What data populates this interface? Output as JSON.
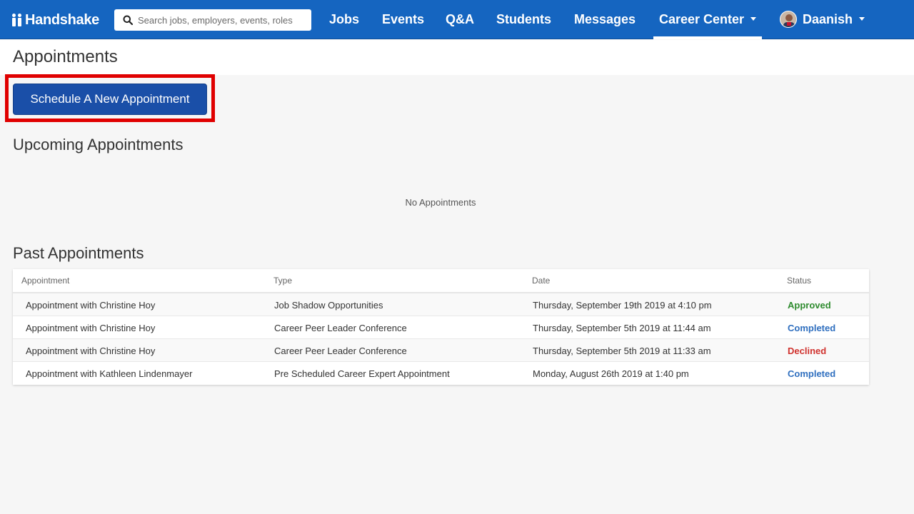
{
  "app": {
    "name": "Handshake"
  },
  "search": {
    "placeholder": "Search jobs, employers, events, roles"
  },
  "nav": {
    "items": [
      {
        "label": "Jobs"
      },
      {
        "label": "Events"
      },
      {
        "label": "Q&A"
      },
      {
        "label": "Students"
      },
      {
        "label": "Messages"
      },
      {
        "label": "Career Center"
      }
    ],
    "user": "Daanish"
  },
  "page": {
    "title": "Appointments",
    "schedule_button": "Schedule A New Appointment",
    "upcoming_title": "Upcoming Appointments",
    "upcoming_empty": "No Appointments",
    "past_title": "Past Appointments"
  },
  "past_table": {
    "headers": [
      "Appointment",
      "Type",
      "Date",
      "Status"
    ],
    "rows": [
      {
        "appointment": "Appointment with Christine Hoy",
        "type": "Job Shadow Opportunities",
        "date": "Thursday, September 19th 2019 at 4:10 pm",
        "status": "Approved",
        "status_color": "#2e8b2e"
      },
      {
        "appointment": "Appointment with Christine Hoy",
        "type": "Career Peer Leader Conference",
        "date": "Thursday, September 5th 2019 at 11:44 am",
        "status": "Completed",
        "status_color": "#2f6fbf"
      },
      {
        "appointment": "Appointment with Christine Hoy",
        "type": "Career Peer Leader Conference",
        "date": "Thursday, September 5th 2019 at 11:33 am",
        "status": "Declined",
        "status_color": "#d0312d"
      },
      {
        "appointment": "Appointment with Kathleen Lindenmayer",
        "type": "Pre Scheduled Career Expert Appointment",
        "date": "Monday, August 26th 2019 at 1:40 pm",
        "status": "Completed",
        "status_color": "#2f6fbf"
      }
    ]
  },
  "colors": {
    "brand": "#1565c0",
    "button": "#1a4fa8",
    "highlight": "#e00000"
  }
}
